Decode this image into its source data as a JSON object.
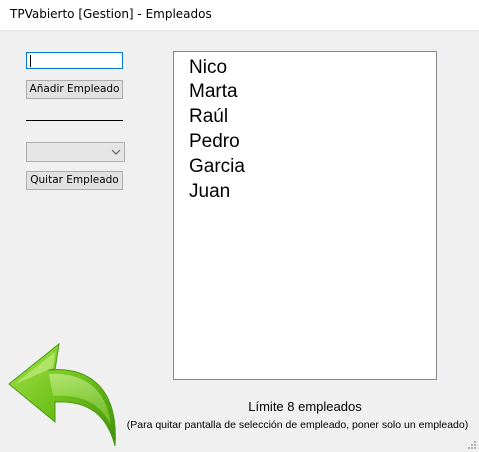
{
  "window": {
    "title": "TPVabierto [Gestion] - Empleados"
  },
  "left_panel": {
    "name_input_value": "",
    "add_button_label": "Añadir Empleado",
    "employee_select_value": "",
    "remove_button_label": "Quitar Empleado"
  },
  "employees": [
    "Nico",
    "Marta",
    "Raúl",
    "Pedro",
    "Garcia",
    "Juan"
  ],
  "footer": {
    "limit_text": "Límite 8 empleados",
    "hint_text": "(Para quitar pantalla de selección de empleado, poner solo un empleado)"
  },
  "icons": {
    "back": "back-arrow-icon",
    "dropdown": "chevron-down-icon",
    "resize": "resize-grip-icon"
  },
  "colors": {
    "arrow_green": "#6fc21b",
    "focus_border": "#0078d7"
  }
}
